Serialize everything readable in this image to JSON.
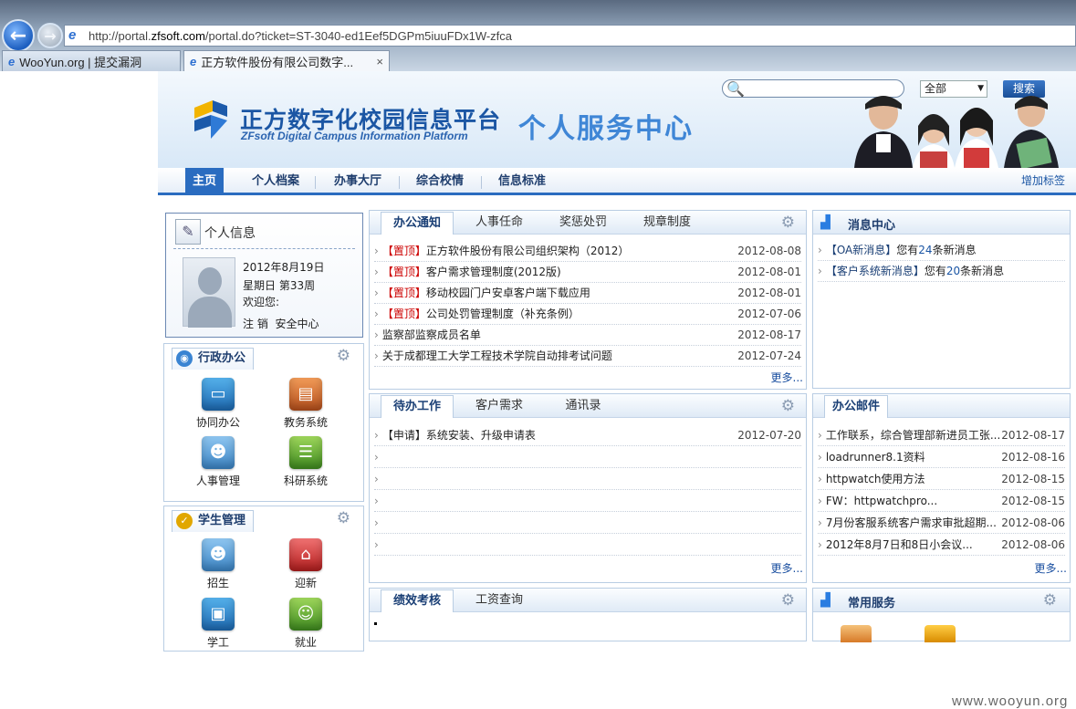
{
  "browser": {
    "url_prefix": "http://portal.",
    "url_domain": "zfsoft.com",
    "url_suffix": "/portal.do?ticket=ST-3040-ed1Eef5DGPm5iuuFDx1W-zfca",
    "tabs": [
      {
        "label": "WooYun.org | 提交漏洞"
      },
      {
        "label": "正方软件股份有限公司数字...",
        "close": "×"
      }
    ]
  },
  "header": {
    "title": "正方数字化校园信息平台",
    "subtitle": "ZFsoft Digital Campus Information Platform",
    "center": "个人服务中心",
    "scope_value": "全部",
    "search_button": "搜索"
  },
  "nav": {
    "items": [
      "主页",
      "个人档案",
      "办事大厅",
      "综合校情",
      "信息标准"
    ],
    "add_tag": "增加标签"
  },
  "profile": {
    "title": "个人信息",
    "date": "2012年8月19日",
    "weekday": "星期日",
    "week": "第33周",
    "welcome": "欢迎您:",
    "logout": "注 销",
    "security": "安全中心"
  },
  "admin_panel": {
    "title": "行政办公",
    "apps": [
      "协同办公",
      "教务系统",
      "人事管理",
      "科研系统"
    ]
  },
  "student_panel": {
    "title": "学生管理",
    "apps": [
      "招生",
      "迎新",
      "学工",
      "就业"
    ]
  },
  "notice_panel": {
    "tabs": [
      "办公通知",
      "人事任命",
      "奖惩处罚",
      "规章制度"
    ],
    "more": "更多...",
    "items": [
      {
        "tag": "【置顶】",
        "text": "正方软件股份有限公司组织架构（2012）",
        "date": "2012-08-08"
      },
      {
        "tag": "【置顶】",
        "text": "客户需求管理制度(2012版)",
        "date": "2012-08-01"
      },
      {
        "tag": "【置顶】",
        "text": "移动校园门户安卓客户端下载应用",
        "date": "2012-08-01"
      },
      {
        "tag": "【置顶】",
        "text": "公司处罚管理制度（补充条例）",
        "date": "2012-07-06"
      },
      {
        "tag": "",
        "text": "监察部监察成员名单",
        "date": "2012-08-17"
      },
      {
        "tag": "",
        "text": "关于成都理工大学工程技术学院自动排考试问题",
        "date": "2012-07-24"
      }
    ]
  },
  "todo_panel": {
    "tabs": [
      "待办工作",
      "客户需求",
      "通讯录"
    ],
    "more": "更多...",
    "items": [
      {
        "text": "【申请】系统安装、升级申请表",
        "date": "2012-07-20"
      }
    ]
  },
  "perf_panel": {
    "tabs": [
      "绩效考核",
      "工资查询"
    ]
  },
  "message_panel": {
    "title": "消息中心",
    "items": [
      {
        "tag": "【OA新消息】",
        "pre": "您有",
        "count": "24",
        "post": "条新消息"
      },
      {
        "tag": "【客户系统新消息】",
        "pre": "您有",
        "count": "20",
        "post": "条新消息"
      }
    ]
  },
  "mail_panel": {
    "title": "办公邮件",
    "more": "更多...",
    "items": [
      {
        "text": "工作联系，综合管理部新进员工张...",
        "date": "2012-08-17"
      },
      {
        "text": "loadrunner8.1资料",
        "date": "2012-08-16"
      },
      {
        "text": "httpwatch使用方法",
        "date": "2012-08-15"
      },
      {
        "text": "FW：httpwatchpro...",
        "date": "2012-08-15"
      },
      {
        "text": "7月份客服系统客户需求审批超期...",
        "date": "2012-08-06"
      },
      {
        "text": "2012年8月7日和8日小会议...",
        "date": "2012-08-06"
      }
    ]
  },
  "service_panel": {
    "title": "常用服务"
  },
  "watermark": "www.wooyun.org"
}
